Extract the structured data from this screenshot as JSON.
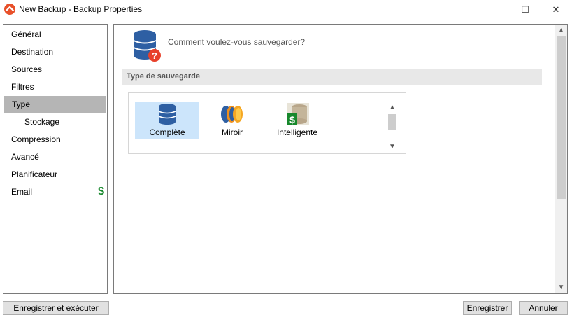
{
  "window": {
    "title": "New Backup - Backup Properties",
    "icon": "app-logo-icon",
    "controls": {
      "minimize": "—",
      "maximize": "☐",
      "close": "✕"
    }
  },
  "sidebar": {
    "items": [
      {
        "label": "Général",
        "active": false
      },
      {
        "label": "Destination",
        "active": false
      },
      {
        "label": "Sources",
        "active": false
      },
      {
        "label": "Filtres",
        "active": false
      },
      {
        "label": "Type",
        "active": true
      },
      {
        "label": "Stockage",
        "active": false,
        "sub": true
      },
      {
        "label": "Compression",
        "active": false
      },
      {
        "label": "Avancé",
        "active": false
      },
      {
        "label": "Planificateur",
        "active": false
      },
      {
        "label": "Email",
        "active": false,
        "badge": "$"
      }
    ]
  },
  "main": {
    "question": "Comment voulez-vous sauvegarder?",
    "section_title": "Type de sauvegarde",
    "types": [
      {
        "label": "Complète",
        "icon": "database-full-icon",
        "selected": true
      },
      {
        "label": "Miroir",
        "icon": "database-mirror-icon",
        "selected": false
      },
      {
        "label": "Intelligente",
        "icon": "database-smart-icon",
        "selected": false
      }
    ]
  },
  "footer": {
    "run_label": "Enregistrer et exécuter",
    "save_label": "Enregistrer",
    "cancel_label": "Annuler"
  },
  "colors": {
    "accent_blue": "#2e5fa3",
    "selected_bg": "#cce5fb",
    "dollar_green": "#17882c",
    "question_red": "#e8402a"
  }
}
